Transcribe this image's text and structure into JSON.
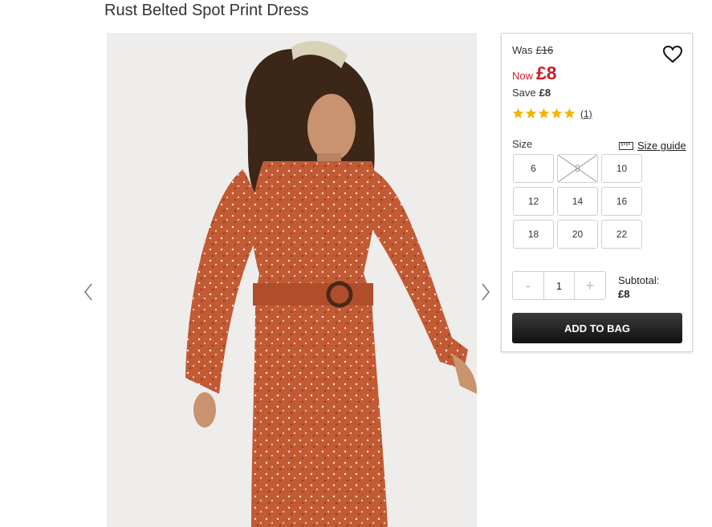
{
  "product": {
    "title": "Rust Belted Spot Print Dress"
  },
  "pricing": {
    "was_label": "Was",
    "was_price": "£16",
    "now_label": "Now",
    "now_price": "£8",
    "save_label": "Save",
    "save_amount": "£8"
  },
  "rating": {
    "stars": 5,
    "review_count": "(1)"
  },
  "size": {
    "label": "Size",
    "guide_label": "Size guide",
    "options": [
      {
        "label": "6",
        "available": true
      },
      {
        "label": "8",
        "available": false
      },
      {
        "label": "10",
        "available": true
      },
      {
        "label": "12",
        "available": true
      },
      {
        "label": "14",
        "available": true
      },
      {
        "label": "16",
        "available": true
      },
      {
        "label": "18",
        "available": true
      },
      {
        "label": "20",
        "available": true
      },
      {
        "label": "22",
        "available": true
      }
    ]
  },
  "quantity": {
    "minus": "-",
    "value": "1",
    "plus": "+"
  },
  "subtotal": {
    "label": "Subtotal:",
    "amount": "£8"
  },
  "actions": {
    "add_to_bag": "ADD TO BAG"
  },
  "icons": {
    "wishlist": "heart-icon",
    "prev": "chevron-left-icon",
    "next": "chevron-right-icon",
    "star": "star-icon",
    "size_guide": "ruler-icon"
  },
  "colors": {
    "price_red": "#d11b24",
    "star_gold": "#f5b300",
    "button_dark": "#1e1e1e",
    "dress_rust": "#c25a34"
  }
}
